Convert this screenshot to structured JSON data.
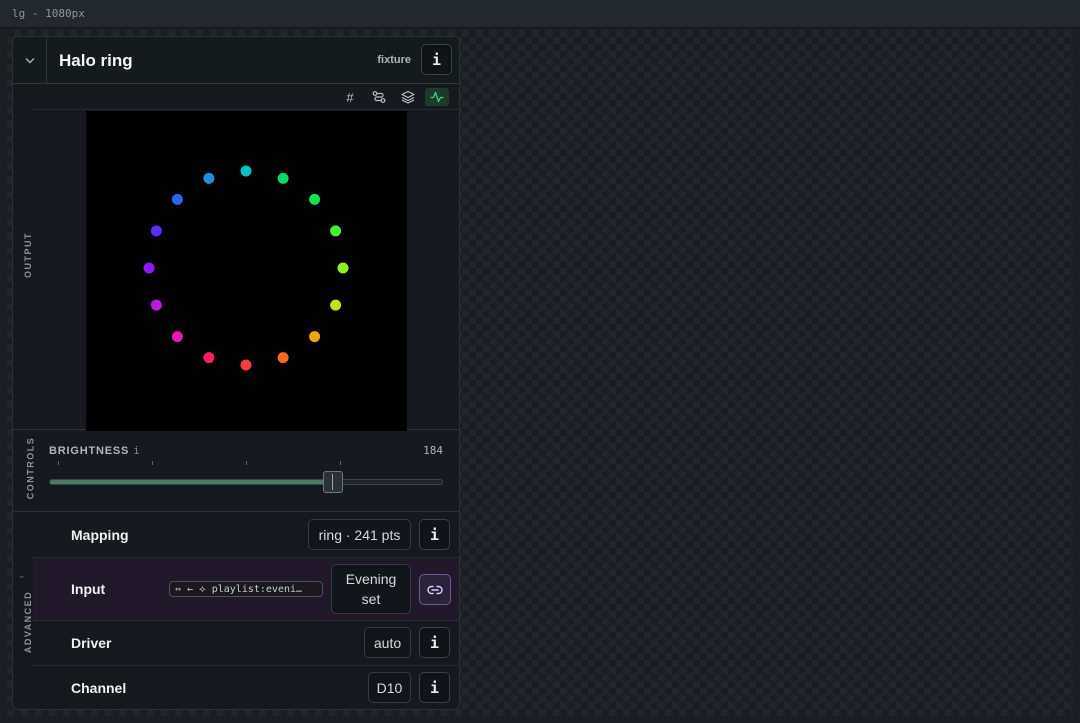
{
  "window": {
    "title": "lg - 1080px"
  },
  "panel": {
    "title": "Halo ring",
    "tag": "fixture",
    "info_label": "i"
  },
  "sections": {
    "output": "OUTPUT",
    "controls": "CONTROLS",
    "advanced": "ADVANCED"
  },
  "toolbar": {
    "items": [
      {
        "icon": "grid-hash-icon",
        "glyph": "#"
      },
      {
        "icon": "route-icon"
      },
      {
        "icon": "layers-icon"
      },
      {
        "icon": "activity-icon",
        "active": true
      }
    ]
  },
  "output": {
    "led_colors": [
      "#00c2c7",
      "#00d96b",
      "#13e34a",
      "#44f232",
      "#8ef21e",
      "#c2e01b",
      "#e8a815",
      "#ff6a1f",
      "#ff3b3b",
      "#ff2062",
      "#e81aa8",
      "#bf18e0",
      "#8d18f6",
      "#5a2cf8",
      "#2c63f2",
      "#1e8fdd"
    ]
  },
  "controls": {
    "brightness_label": "BRIGHTNESS",
    "brightness_info": "i",
    "brightness_value": "184",
    "brightness_fraction": 0.7216,
    "accent": "#4d7a62"
  },
  "advanced": {
    "rows": [
      {
        "label": "Mapping",
        "value": "ring · 241 pts",
        "button": "i"
      },
      {
        "label": "Input",
        "source": "⇔ ← ⟡ playlist:eveni…",
        "value": "Evening set",
        "button": "link"
      },
      {
        "label": "Driver",
        "value": "auto",
        "button": "i"
      },
      {
        "label": "Channel",
        "value": "D10",
        "button": "i"
      }
    ],
    "input_line1": "Evening",
    "input_line2": "set"
  }
}
